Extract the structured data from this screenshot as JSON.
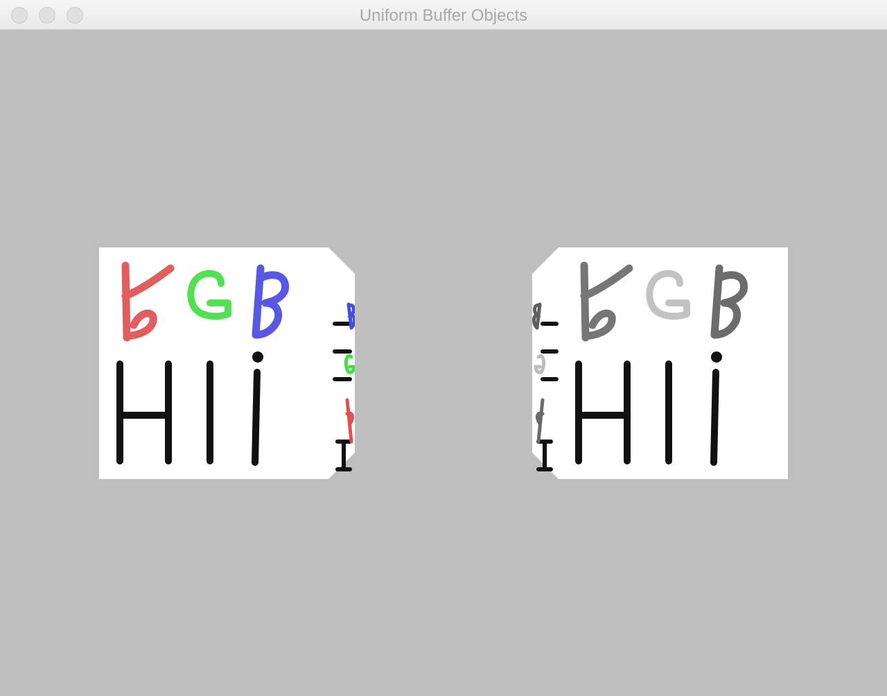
{
  "window": {
    "title": "Uniform Buffer Objects",
    "background_color": "#bebebe"
  },
  "cubes": [
    {
      "name": "color",
      "palette": {
        "r": "#e05050",
        "g": "#44dd44",
        "b": "#4a4ae0",
        "ink": "#111111"
      }
    },
    {
      "name": "grayscale",
      "palette": {
        "r": "#6a6a6a",
        "g": "#bdbdbd",
        "b": "#5f5f5f",
        "ink": "#111111"
      }
    }
  ]
}
